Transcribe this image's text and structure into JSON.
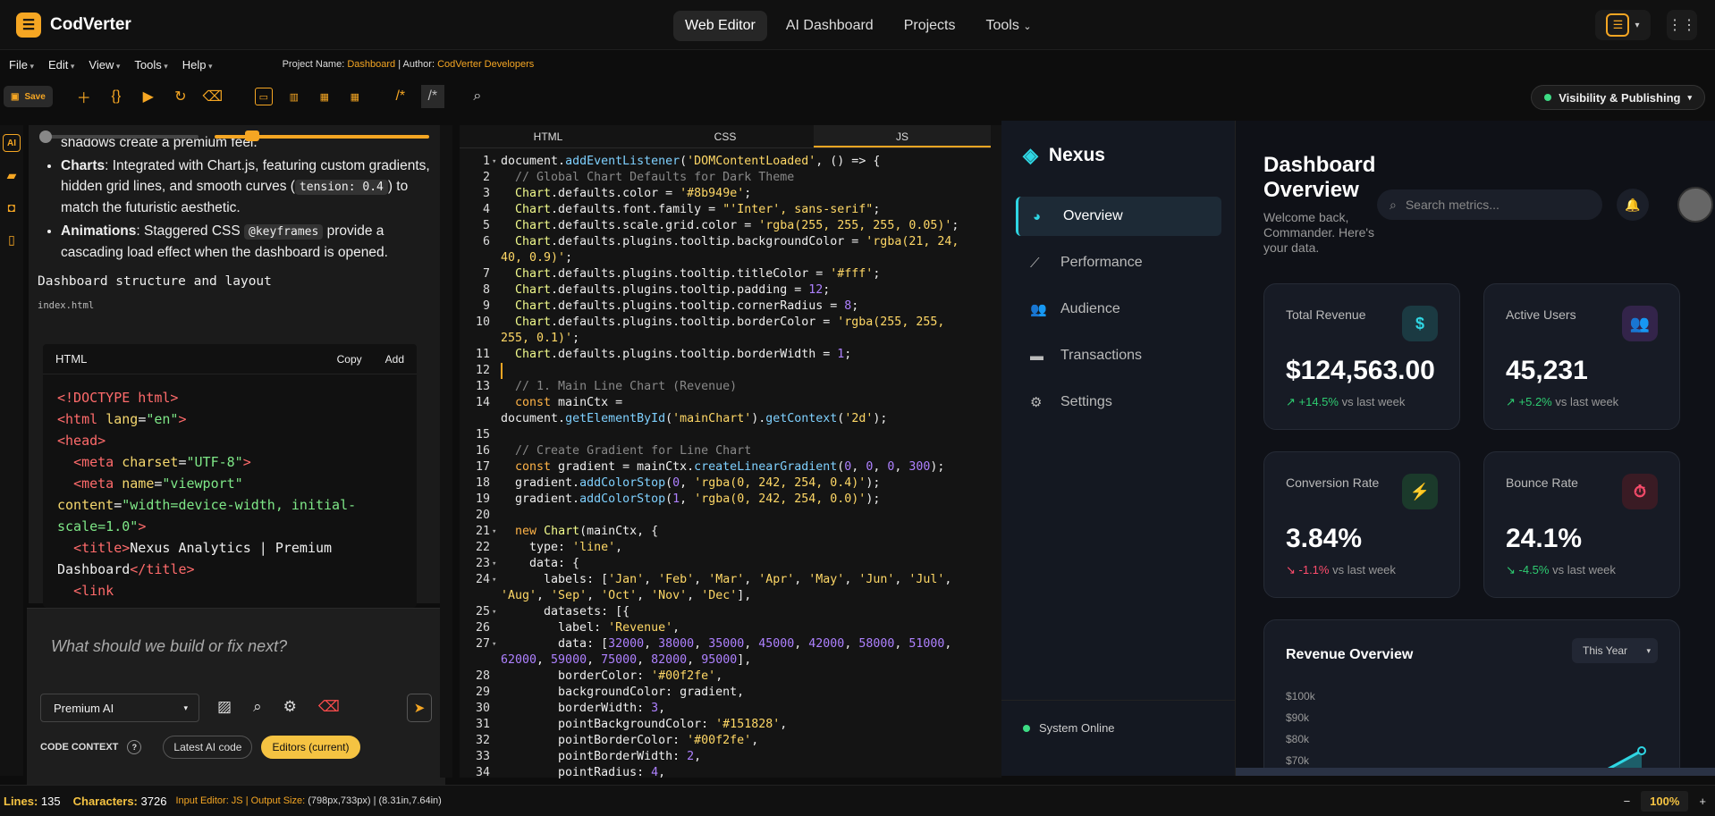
{
  "app": {
    "name": "CodVerter",
    "logo_glyph": "☰"
  },
  "topnav": {
    "items": [
      "Web Editor",
      "AI Dashboard",
      "Projects",
      "Tools"
    ],
    "active": "Web Editor"
  },
  "menu": [
    "File",
    "Edit",
    "View",
    "Tools",
    "Help"
  ],
  "project": {
    "name_label": "Project Name:",
    "name": "Dashboard",
    "author_label": "| Author:",
    "author": "CodVerter Developers"
  },
  "toolbar": {
    "save_label": "Save",
    "visibility_label": "Visibility & Publishing"
  },
  "chat": {
    "bullet0_tail": "shadows create a premium feel.",
    "bullet1_title": "Charts",
    "bullet1_text": ": Integrated with Chart.js, featuring custom gradients, hidden grid lines, and smooth curves (",
    "bullet1_code": "tension: 0.4",
    "bullet1_tail": ") to match the futuristic aesthetic.",
    "bullet2_title": "Animations",
    "bullet2_text": ": Staggered CSS ",
    "bullet2_code": "@keyframes",
    "bullet2_tail": " provide a cascading load effect when the dashboard is opened.",
    "section": "Dashboard structure and layout",
    "file": "index.html",
    "code_lang": "HTML",
    "copy": "Copy",
    "add": "Add"
  },
  "prompt": {
    "placeholder": "What should we build or fix next?",
    "model": "Premium AI",
    "ctx_label": "CODE CONTEXT",
    "ctx_opt1": "Latest AI code",
    "ctx_opt2": "Editors (current)"
  },
  "editor": {
    "tabs": [
      "HTML",
      "CSS",
      "JS"
    ],
    "active": "JS"
  },
  "preview": {
    "brand": "Nexus",
    "nav": [
      "Overview",
      "Performance",
      "Audience",
      "Transactions",
      "Settings"
    ],
    "system": "System Online",
    "title": "Dashboard Overview",
    "welcome": "Welcome back, Commander. Here's your data.",
    "search_placeholder": "Search metrics...",
    "cards": [
      {
        "label": "Total Revenue",
        "value": "$124,563.00",
        "change": "+14.5%",
        "suffix": "vs last week",
        "dir": "up",
        "icon": "$",
        "icon_color": "#2fd6e3",
        "icon_bg": "#1b3a42"
      },
      {
        "label": "Active Users",
        "value": "45,231",
        "change": "+5.2%",
        "suffix": "vs last week",
        "dir": "up",
        "icon": "👥",
        "icon_color": "#c77dff",
        "icon_bg": "#33244a"
      },
      {
        "label": "Conversion Rate",
        "value": "3.84%",
        "change": "-1.1%",
        "suffix": "vs last week",
        "dir": "down",
        "icon": "⚡",
        "icon_color": "#2ecc71",
        "icon_bg": "#1b3a2b"
      },
      {
        "label": "Bounce Rate",
        "value": "24.1%",
        "change": "-4.5%",
        "suffix": "vs last week",
        "dir": "up",
        "icon": "⏱",
        "icon_color": "#ff4d6d",
        "icon_bg": "#3a1b24"
      }
    ],
    "revenue": {
      "title": "Revenue Overview",
      "range": "This Year",
      "ylabels": [
        "$100k",
        "$90k",
        "$80k",
        "$70k"
      ]
    }
  },
  "status": {
    "lines_label": "Lines:",
    "lines": "135",
    "chars_label": "Characters:",
    "chars": "3726",
    "info_label": "Input Editor: JS | Output Size:",
    "info_value": "(798px,733px) | (8.31in,7.64in)",
    "zoom": "100%"
  }
}
